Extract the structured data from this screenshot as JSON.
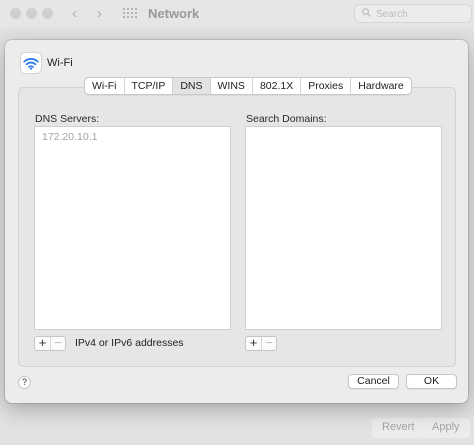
{
  "background_window": {
    "title": "Network",
    "search_placeholder": "Search",
    "nav_back": "‹",
    "nav_forward": "›",
    "revert_label": "Revert",
    "apply_label": "Apply"
  },
  "sheet": {
    "title": "Wi-Fi",
    "icon": "wifi-icon",
    "tabs": [
      {
        "label": "Wi-Fi"
      },
      {
        "label": "TCP/IP"
      },
      {
        "label": "DNS",
        "active": true
      },
      {
        "label": "WINS"
      },
      {
        "label": "802.1X"
      },
      {
        "label": "Proxies"
      },
      {
        "label": "Hardware"
      }
    ],
    "dns": {
      "label": "DNS Servers:",
      "entries": [
        "172.20.10.1"
      ],
      "hint": "IPv4 or IPv6 addresses",
      "add": "+",
      "remove": "−"
    },
    "search_domains": {
      "label": "Search Domains:",
      "add": "+",
      "remove": "−"
    },
    "help": "?",
    "cancel_label": "Cancel",
    "ok_label": "OK"
  },
  "colors": {
    "wifi_blue": "#2f7ff0",
    "sheet_bg": "#ececec",
    "placeholder_text": "#a3a3a3"
  }
}
